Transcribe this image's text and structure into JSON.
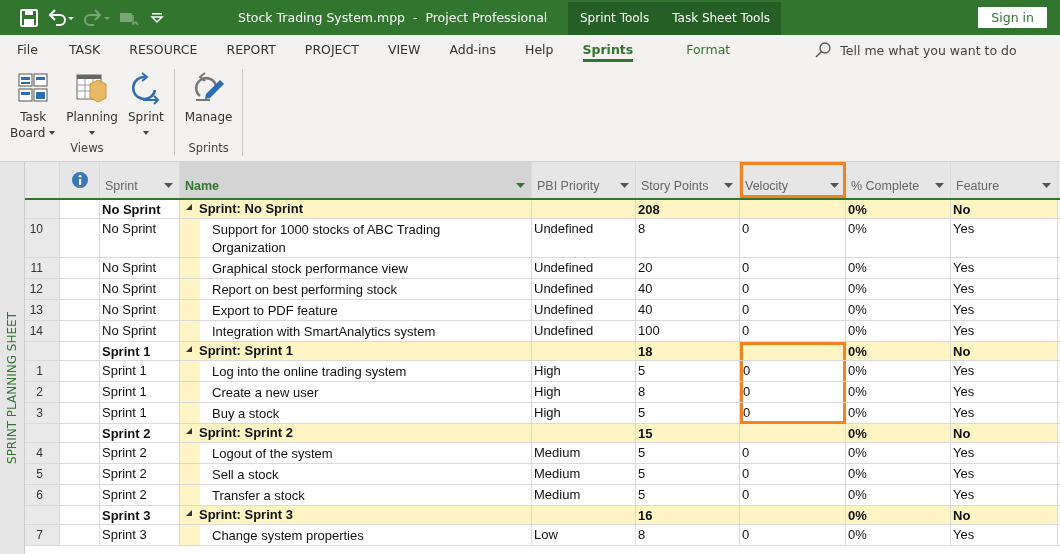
{
  "window": {
    "title": "Stock Trading System.mpp  -  Project Professional",
    "context_tabs": [
      "Sprint Tools",
      "Task Sheet Tools"
    ],
    "sign_in": "Sign in"
  },
  "quick_access": [
    {
      "kind": "save",
      "disabled": false
    },
    {
      "kind": "undo",
      "disabled": false
    },
    {
      "kind": "redo",
      "disabled": true
    },
    {
      "kind": "touch",
      "disabled": true
    },
    {
      "kind": "customize",
      "disabled": false
    }
  ],
  "ribbon_tabs": [
    {
      "label": "File",
      "selected": false,
      "contextual": false
    },
    {
      "label": "TASK",
      "selected": false,
      "contextual": false
    },
    {
      "label": "RESOURCE",
      "selected": false,
      "contextual": false
    },
    {
      "label": "REPORT",
      "selected": false,
      "contextual": false
    },
    {
      "label": "PROJECT",
      "selected": false,
      "contextual": false
    },
    {
      "label": "VIEW",
      "selected": false,
      "contextual": false
    },
    {
      "label": "Add-ins",
      "selected": false,
      "contextual": false
    },
    {
      "label": "Help",
      "selected": false,
      "contextual": false
    },
    {
      "label": "Sprints",
      "selected": true,
      "contextual": true
    },
    {
      "label": "Format",
      "selected": false,
      "contextual": true
    }
  ],
  "tell_me": {
    "placeholder": "Tell me what you want to do"
  },
  "ribbon_groups": [
    {
      "label": "Views",
      "buttons": [
        {
          "kind": "taskboard",
          "lines": [
            "Task",
            "Board"
          ],
          "dropdown": true,
          "inline_caret": true
        },
        {
          "kind": "planning",
          "lines": [
            "Planning"
          ],
          "dropdown": true,
          "inline_caret": false
        },
        {
          "kind": "sprint",
          "lines": [
            "Sprint"
          ],
          "dropdown": true,
          "inline_caret": false
        }
      ]
    },
    {
      "label": "Sprints",
      "buttons": [
        {
          "kind": "manage",
          "lines": [
            "Manage"
          ],
          "dropdown": false
        }
      ]
    }
  ],
  "side_label": "SPRINT PLANNING SHEET",
  "table": {
    "columns": [
      {
        "label": "Sprint",
        "sorted": false,
        "highlighted": false
      },
      {
        "label": "Name",
        "sorted": true,
        "highlighted": false
      },
      {
        "label": "PBI Priority",
        "sorted": false,
        "highlighted": false
      },
      {
        "label": "Story Points",
        "sorted": false,
        "highlighted": false
      },
      {
        "label": "Velocity",
        "sorted": false,
        "highlighted": true
      },
      {
        "label": "% Complete",
        "sorted": false,
        "highlighted": false
      },
      {
        "label": "Feature",
        "sorted": false,
        "highlighted": false
      }
    ],
    "groups": [
      {
        "sprint": "No Sprint",
        "name": "Sprint: No Sprint",
        "expanded": true,
        "story_points": "208",
        "complete": "0%",
        "feature": "No",
        "velocity_highlighted": false,
        "rows": [
          {
            "id": "10",
            "sprint": "No Sprint",
            "name": "Support for 1000 stocks of ABC Trading Organization",
            "priority": "Undefined",
            "story_points": "8",
            "velocity": "0",
            "complete": "0%",
            "feature": "Yes"
          },
          {
            "id": "11",
            "sprint": "No Sprint",
            "name": "Graphical stock performance view",
            "priority": "Undefined",
            "story_points": "20",
            "velocity": "0",
            "complete": "0%",
            "feature": "Yes"
          },
          {
            "id": "12",
            "sprint": "No Sprint",
            "name": "Report on best performing stock",
            "priority": "Undefined",
            "story_points": "40",
            "velocity": "0",
            "complete": "0%",
            "feature": "Yes"
          },
          {
            "id": "13",
            "sprint": "No Sprint",
            "name": "Export to PDF feature",
            "priority": "Undefined",
            "story_points": "40",
            "velocity": "0",
            "complete": "0%",
            "feature": "Yes"
          },
          {
            "id": "14",
            "sprint": "No Sprint",
            "name": "Integration with SmartAnalytics system",
            "priority": "Undefined",
            "story_points": "100",
            "velocity": "0",
            "complete": "0%",
            "feature": "Yes"
          }
        ]
      },
      {
        "sprint": "Sprint 1",
        "name": "Sprint: Sprint 1",
        "expanded": true,
        "story_points": "18",
        "complete": "0%",
        "feature": "No",
        "velocity_highlighted": true,
        "rows": [
          {
            "id": "1",
            "sprint": "Sprint 1",
            "name": "Log into the online trading system",
            "priority": "High",
            "story_points": "5",
            "velocity": "0",
            "complete": "0%",
            "feature": "Yes"
          },
          {
            "id": "2",
            "sprint": "Sprint 1",
            "name": "Create a new user",
            "priority": "High",
            "story_points": "8",
            "velocity": "0",
            "complete": "0%",
            "feature": "Yes"
          },
          {
            "id": "3",
            "sprint": "Sprint 1",
            "name": "Buy a stock",
            "priority": "High",
            "story_points": "5",
            "velocity": "0",
            "complete": "0%",
            "feature": "Yes"
          }
        ]
      },
      {
        "sprint": "Sprint 2",
        "name": "Sprint: Sprint 2",
        "expanded": true,
        "story_points": "15",
        "complete": "0%",
        "feature": "No",
        "velocity_highlighted": false,
        "rows": [
          {
            "id": "4",
            "sprint": "Sprint 2",
            "name": "Logout of the system",
            "priority": "Medium",
            "story_points": "5",
            "velocity": "0",
            "complete": "0%",
            "feature": "Yes"
          },
          {
            "id": "5",
            "sprint": "Sprint 2",
            "name": "Sell a stock",
            "priority": "Medium",
            "story_points": "5",
            "velocity": "0",
            "complete": "0%",
            "feature": "Yes"
          },
          {
            "id": "6",
            "sprint": "Sprint 2",
            "name": "Transfer a stock",
            "priority": "Medium",
            "story_points": "5",
            "velocity": "0",
            "complete": "0%",
            "feature": "Yes"
          }
        ]
      },
      {
        "sprint": "Sprint 3",
        "name": "Sprint: Sprint 3",
        "expanded": true,
        "story_points": "16",
        "complete": "0%",
        "feature": "No",
        "velocity_highlighted": false,
        "rows": [
          {
            "id": "7",
            "sprint": "Sprint 3",
            "name": "Change system properties",
            "priority": "Low",
            "story_points": "8",
            "velocity": "0",
            "complete": "0%",
            "feature": "Yes"
          }
        ]
      }
    ]
  }
}
